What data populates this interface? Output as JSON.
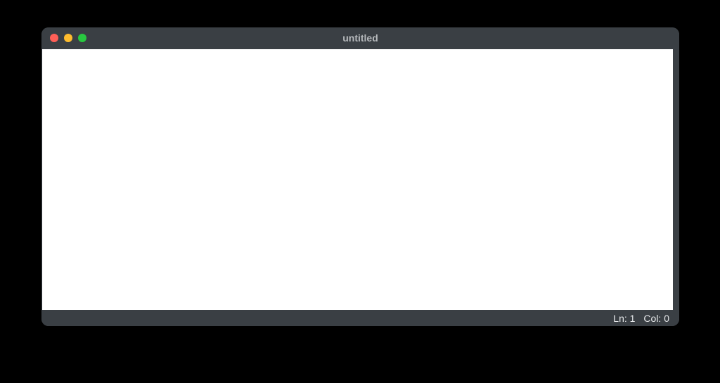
{
  "window": {
    "title": "untitled"
  },
  "editor": {
    "content": ""
  },
  "status": {
    "line_label": "Ln: 1",
    "col_label": "Col: 0"
  }
}
